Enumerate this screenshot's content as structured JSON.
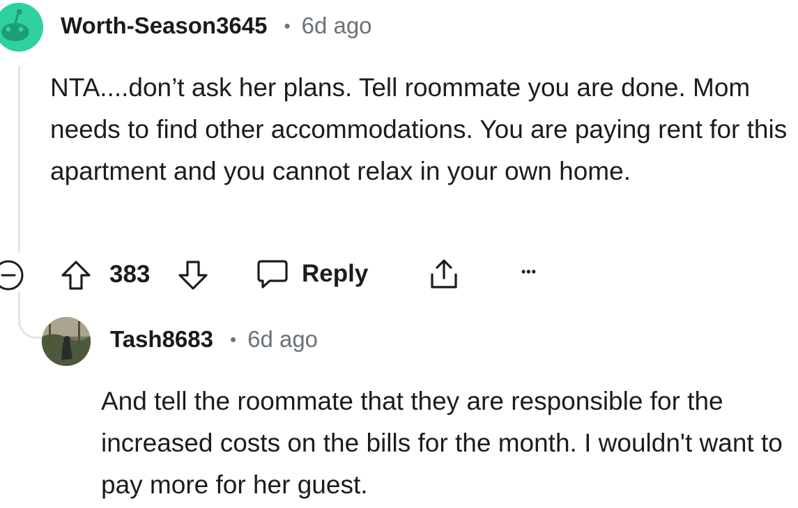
{
  "comments": [
    {
      "username": "Worth-Season3645",
      "separator": "•",
      "time": "6d ago",
      "body": "NTA....don’t ask her plans. Tell roommate you are done. Mom needs to find other accommodations. You are paying rent for this apartment and you cannot relax in your own home.",
      "score": "383",
      "reply_label": "Reply",
      "more_label": "•••"
    },
    {
      "username": "Tash8683",
      "separator": "•",
      "time": "6d ago",
      "body": "And tell the roommate that they are responsible for the increased costs on the bills for the month. I wouldn't want to pay more for her guest."
    }
  ],
  "icons": {
    "collapse": "collapse-icon",
    "upvote": "upvote-icon",
    "downvote": "downvote-icon",
    "reply": "reply-bubble-icon",
    "share": "share-icon",
    "more": "more-options-icon"
  },
  "colors": {
    "avatar_snoo": "#2fd1a0",
    "meta_gray": "#6b7277",
    "thread_line": "#e5e5e5"
  }
}
